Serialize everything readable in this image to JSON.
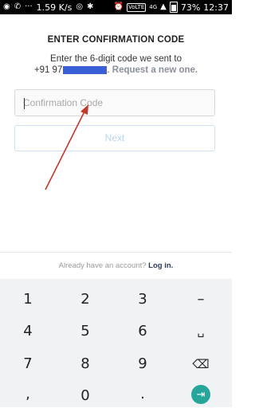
{
  "status_bar": {
    "speed": "1.59 K/s",
    "battery_percent": "73%",
    "time": "12:37",
    "volte_label": "VoLTE",
    "network_label": "4G",
    "icons": [
      "chrome-icon",
      "whatsapp-icon",
      "more-icon",
      "hotspot-icon",
      "wifi-icon",
      "bluetooth-icon",
      "alarm-icon",
      "signal-icon",
      "battery-icon"
    ]
  },
  "header": {
    "title": "ENTER CONFIRMATION CODE",
    "subtitle_line1": "Enter the 6-digit code we sent to",
    "phone_prefix": "+91 97",
    "phone_suffix": ".",
    "request_link": "Request a new one."
  },
  "form": {
    "code_placeholder": "Confirmation Code",
    "next_label": "Next"
  },
  "footer": {
    "login_prompt": "Already have an account?",
    "login_link": "Log in."
  },
  "keyboard": {
    "rows": [
      [
        "1",
        "2",
        "3",
        "–"
      ],
      [
        "4",
        "5",
        "6",
        "␣"
      ],
      [
        "7",
        "8",
        "9",
        "⌫"
      ],
      [
        ",",
        "0",
        ".",
        "⇥"
      ]
    ]
  },
  "colors": {
    "redaction": "#3b5fd6",
    "next_text": "#b9d4ef",
    "enter_key": "#26a69a",
    "arrow": "#c0392b",
    "keyboard_bg": "#f0f2f5"
  }
}
